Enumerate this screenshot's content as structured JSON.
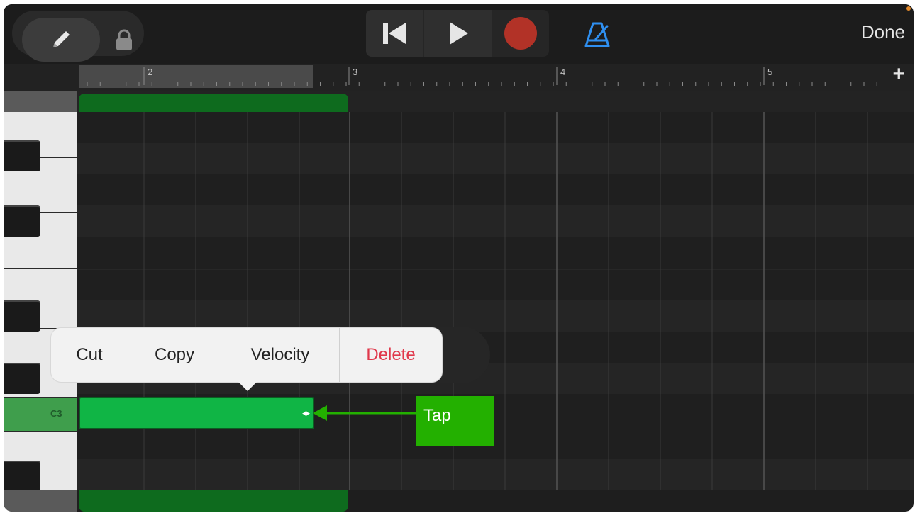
{
  "toolbar": {
    "done_label": "Done",
    "icons": [
      "pencil-icon",
      "lock-icon",
      "rewind-icon",
      "play-icon",
      "record-icon",
      "metronome-icon"
    ],
    "record_color": "#b23227",
    "metronome_color": "#2f8ff0"
  },
  "ruler": {
    "bar_labels": [
      "2",
      "3",
      "4",
      "5"
    ],
    "add_label": "+"
  },
  "keyboard": {
    "highlighted_key_label": "C3",
    "highlight_color": "#3f9e4c"
  },
  "note": {
    "color": "#10b545"
  },
  "context_menu": {
    "items": [
      "Cut",
      "Copy",
      "Velocity",
      "Delete"
    ],
    "delete_color": "#e0384b"
  },
  "annotation": {
    "label": "Tap",
    "color": "#23b000"
  }
}
